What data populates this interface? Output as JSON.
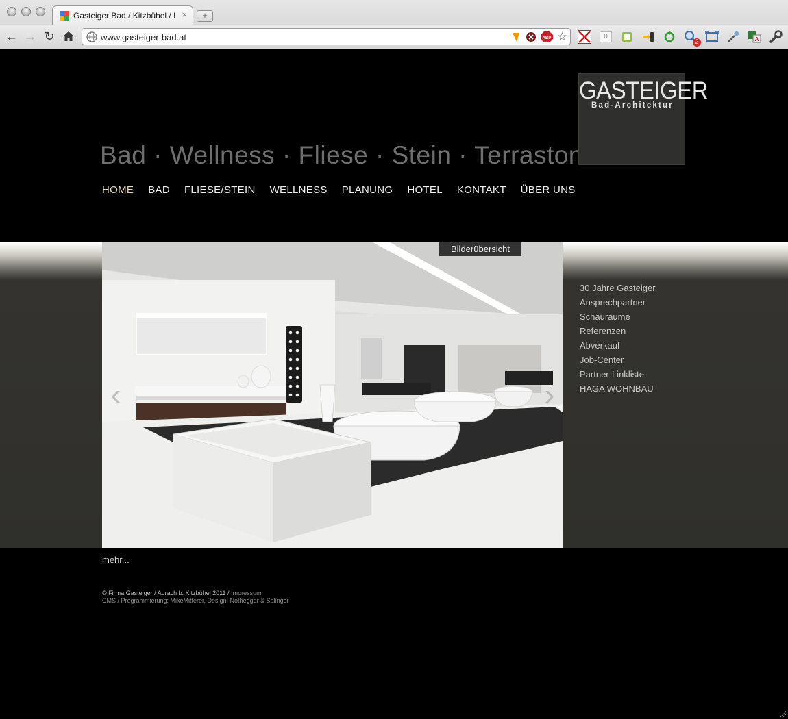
{
  "browser": {
    "tab_title": "Gasteiger Bad / Kitzbühel / B",
    "tab_close": "×",
    "new_tab": "+",
    "url": "www.gasteiger-bad.at",
    "badge_count": "0",
    "zoom_badge": "2"
  },
  "site": {
    "tagline": "Bad · Wellness · Fliese · Stein · Terrastone",
    "logo_name": "GASTEIGER",
    "logo_sub": "Bad-Architektur",
    "nav": [
      {
        "label": "HOME"
      },
      {
        "label": "BAD"
      },
      {
        "label": "FLIESE/STEIN"
      },
      {
        "label": "WELLNESS"
      },
      {
        "label": "PLANUNG"
      },
      {
        "label": "HOTEL"
      },
      {
        "label": "KONTAKT"
      },
      {
        "label": "ÜBER UNS"
      }
    ],
    "active_nav": "HOME",
    "overview_label": "Bilderübersicht",
    "arrow_prev": "‹",
    "arrow_next": "›",
    "sidenav": [
      {
        "label": "30 Jahre Gasteiger"
      },
      {
        "label": "Ansprechpartner"
      },
      {
        "label": "Schauräume"
      },
      {
        "label": "Referenzen"
      },
      {
        "label": "Abverkauf"
      },
      {
        "label": "Job-Center"
      },
      {
        "label": "Partner-Linkliste"
      },
      {
        "label": "HAGA WOHNBAU"
      }
    ],
    "more_label": "mehr...",
    "footer": {
      "copyright": "©  Firma Gasteiger / Aurach b. Kitzbühel 2011 / ",
      "impressum": "Impressum",
      "credits": "CMS / Programmierung: MikeMitterer, Design: Nothegger & Salinger"
    }
  },
  "colors": {
    "background": "#000000",
    "band": "#2f2f2b",
    "nav_active": "#e7dcb4",
    "tagline": "#6e6e6e"
  }
}
